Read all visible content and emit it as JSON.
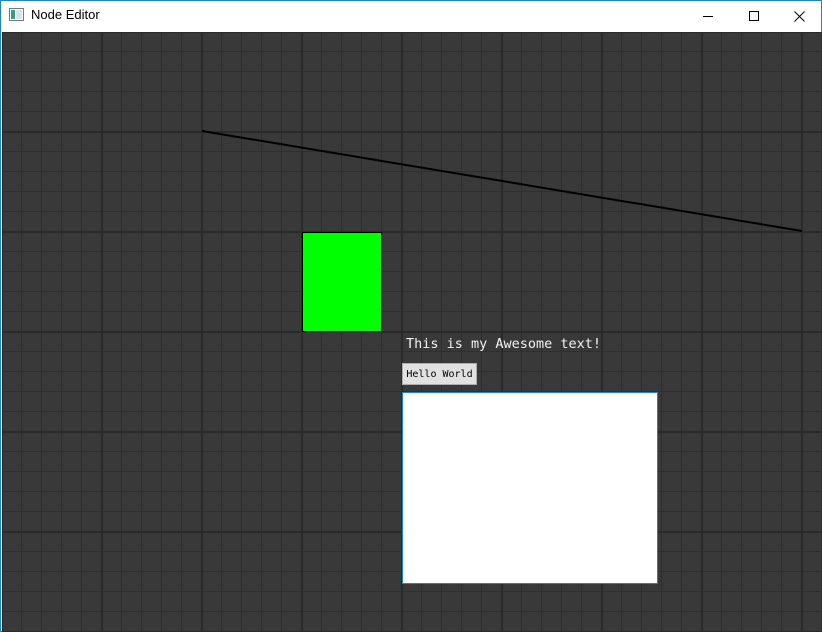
{
  "window": {
    "title": "Node Editor",
    "controls": {
      "minimize": "minimize-icon",
      "maximize": "maximize-icon",
      "close": "close-icon"
    }
  },
  "canvas": {
    "background_color": "#393939",
    "grid_major_color": "#2a2a2a",
    "grid_minor_color": "#2f2f2f",
    "line_color": "#000000",
    "rect_color": "#00ff00",
    "label_text": "This is my Awesome text!",
    "button_label": "Hello World",
    "text_area_value": ""
  }
}
